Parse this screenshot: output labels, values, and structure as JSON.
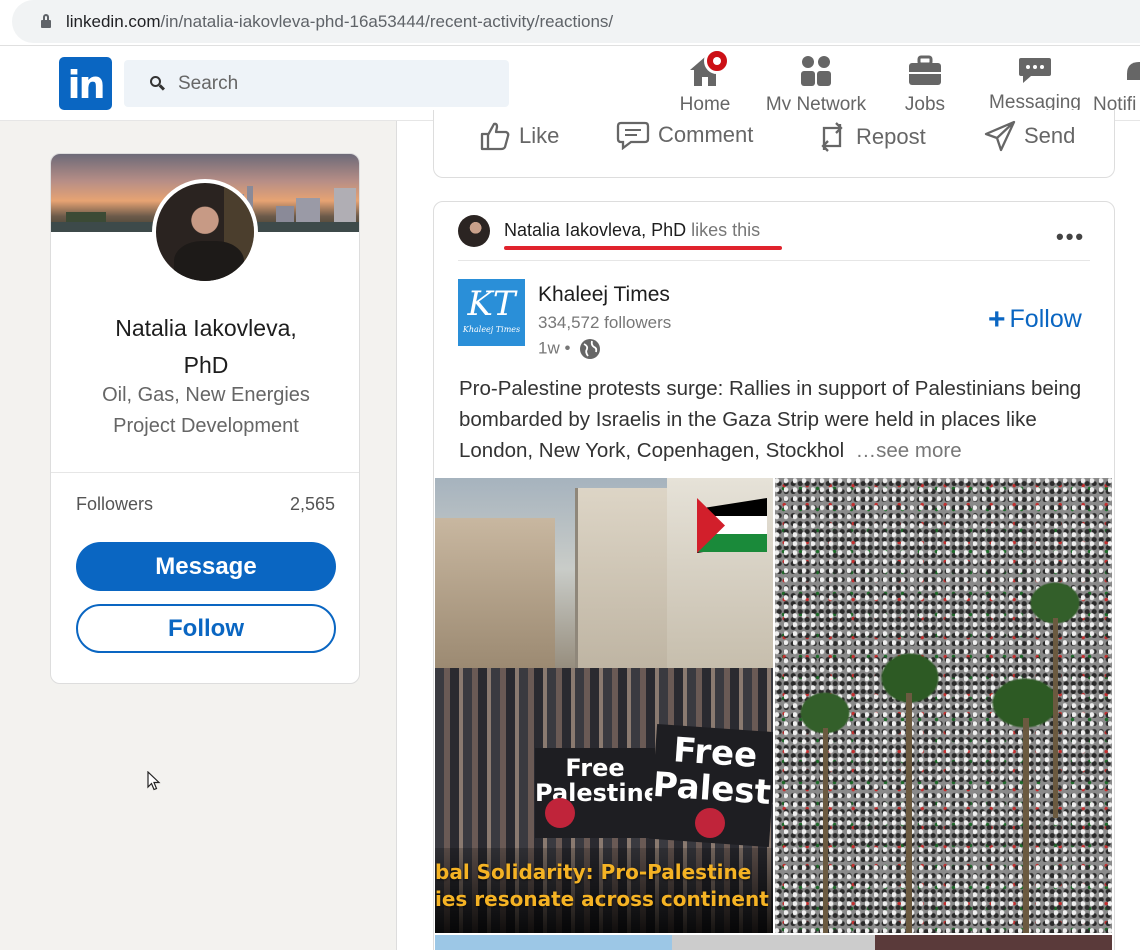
{
  "browser": {
    "url_domain": "linkedin.com",
    "url_path": "/in/natalia-iakovleva-phd-16a53444/recent-activity/reactions/"
  },
  "nav": {
    "logo": "in",
    "search_placeholder": "Search",
    "items": [
      {
        "label": "Home",
        "icon": "home-icon"
      },
      {
        "label": "My Network",
        "icon": "network-icon"
      },
      {
        "label": "Jobs",
        "icon": "briefcase-icon"
      },
      {
        "label": "Messaging",
        "icon": "chat-icon"
      },
      {
        "label": "Notifi",
        "icon": "bell-icon"
      }
    ]
  },
  "profile": {
    "name": "Natalia Iakovleva, PhD",
    "headline": "Oil, Gas, New Energies Project Development",
    "followers_label": "Followers",
    "followers_value": "2,565",
    "message_label": "Message",
    "follow_label": "Follow"
  },
  "prev_post_actions": {
    "like": "Like",
    "comment": "Comment",
    "repost": "Repost",
    "send": "Send"
  },
  "post": {
    "reactor_name": "Natalia Iakovleva, PhD",
    "reactor_action": "likes this",
    "org_name": "Khaleej Times",
    "org_logo_text": "KT",
    "org_logo_sub": "Khaleej Times",
    "org_followers": "334,572 followers",
    "age": "1w •",
    "follow_label": "Follow",
    "text": "Pro-Palestine protests surge: Rallies in support of Palestinians being bombarded by Israelis in the Gaza Strip were held in places like London, New York, Copenhagen, Stockhol",
    "see_more": "…see more",
    "image1": {
      "overlay_line1": "bal Solidarity: Pro-Palestine",
      "overlay_line2": "ies resonate across continent",
      "sign1": "Free Palestine",
      "sign2": "Free Palestin"
    }
  },
  "colors": {
    "linkedin_blue": "#0a66c2",
    "notification_red": "#cc1016",
    "underline_red": "#e0232d",
    "overlay_yellow": "#f5b324"
  }
}
